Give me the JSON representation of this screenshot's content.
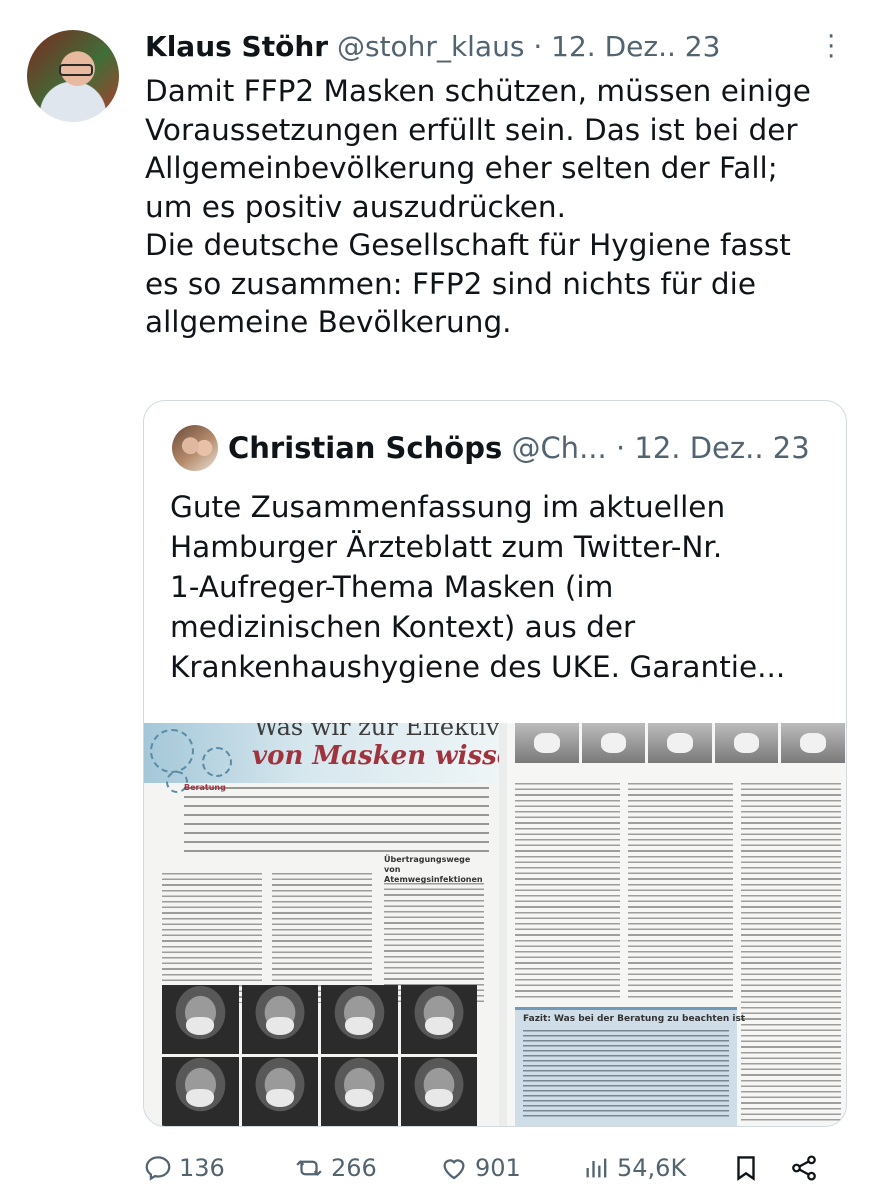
{
  "tweet": {
    "author_name": "Klaus Stöhr",
    "author_handle": "@stohr_klaus",
    "separator": "·",
    "date": "12. Dez.. 23",
    "text": "Damit FFP2 Masken schützen, müssen einige\nVoraussetzungen erfüllt sein. Das ist bei der\nAllgemeinbevölkerung eher selten der Fall;\num es positiv auszudrücken.\nDie deutsche Gesellschaft für Hygiene fasst\nes so zusammen: FFP2 sind nichts für die\nallgemeine Bevölkerung."
  },
  "quoted": {
    "author_name": "Christian Schöps",
    "author_handle": "@Ch...",
    "separator": "·",
    "date": "12. Dez.. 23",
    "text": "Gute Zusammenfassung im aktuellen\nHamburger Ärzteblatt zum Twitter-Nr.\n1-Aufreger-Thema Masken (im\nmedizinischen Kontext) aus der\nKrankenhaushygiene des UKE. Garantie...",
    "image": {
      "title_line1": "Was wir zur Effektivität",
      "title_line2": "von Masken wissen sollten",
      "section_heading": "Übertragungswege von Atemwegsinfektionen",
      "box_title": "Fazit: Was bei der Beratung zu beachten ist",
      "lead_label": "Beratung"
    }
  },
  "actions": {
    "replies": "136",
    "reposts": "266",
    "likes": "901",
    "views": "54,6K"
  },
  "icons": [
    "more-icon",
    "reply-icon",
    "repost-icon",
    "like-icon",
    "views-icon",
    "bookmark-icon",
    "share-icon"
  ]
}
